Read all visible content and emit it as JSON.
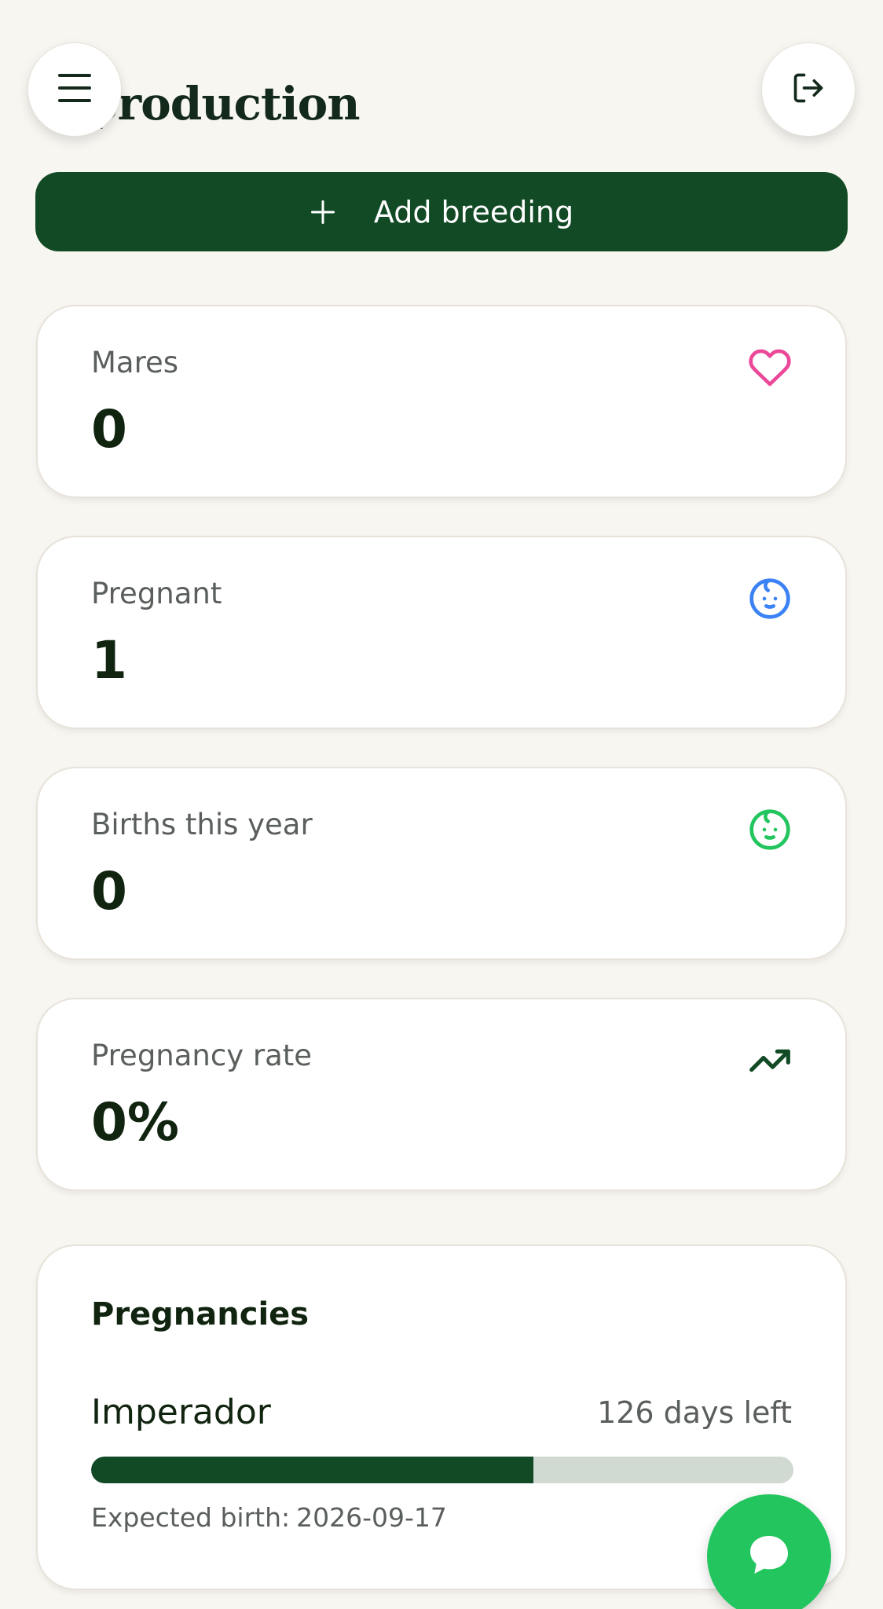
{
  "header": {
    "title": "production",
    "menu_icon": "menu-icon",
    "logout_icon": "logout-icon"
  },
  "actions": {
    "add_breeding_label": "Add breeding",
    "add_icon": "plus-icon"
  },
  "stats": [
    {
      "label": "Mares",
      "value": "0",
      "icon": "heart-icon",
      "color": "#ec4899"
    },
    {
      "label": "Pregnant",
      "value": "1",
      "icon": "baby-icon",
      "color": "#3b82f6"
    },
    {
      "label": "Births this year",
      "value": "0",
      "icon": "baby-icon",
      "color": "#22c55e"
    },
    {
      "label": "Pregnancy rate",
      "value": "0%",
      "icon": "trending-up-icon",
      "color": "#124a26"
    }
  ],
  "pregnancies": {
    "title": "Pregnancies",
    "items": [
      {
        "name": "Imperador",
        "days_left": "126 days left",
        "progress_fraction": 0.63,
        "expected_label": "Expected birth:",
        "expected_date": "2026-09-17"
      }
    ]
  },
  "chat": {
    "icon": "chat-bubble-icon",
    "color": "#22c55e"
  },
  "colors": {
    "primary": "#124a26",
    "background": "#f8f6f1",
    "progress_track": "#d0d9d2"
  }
}
